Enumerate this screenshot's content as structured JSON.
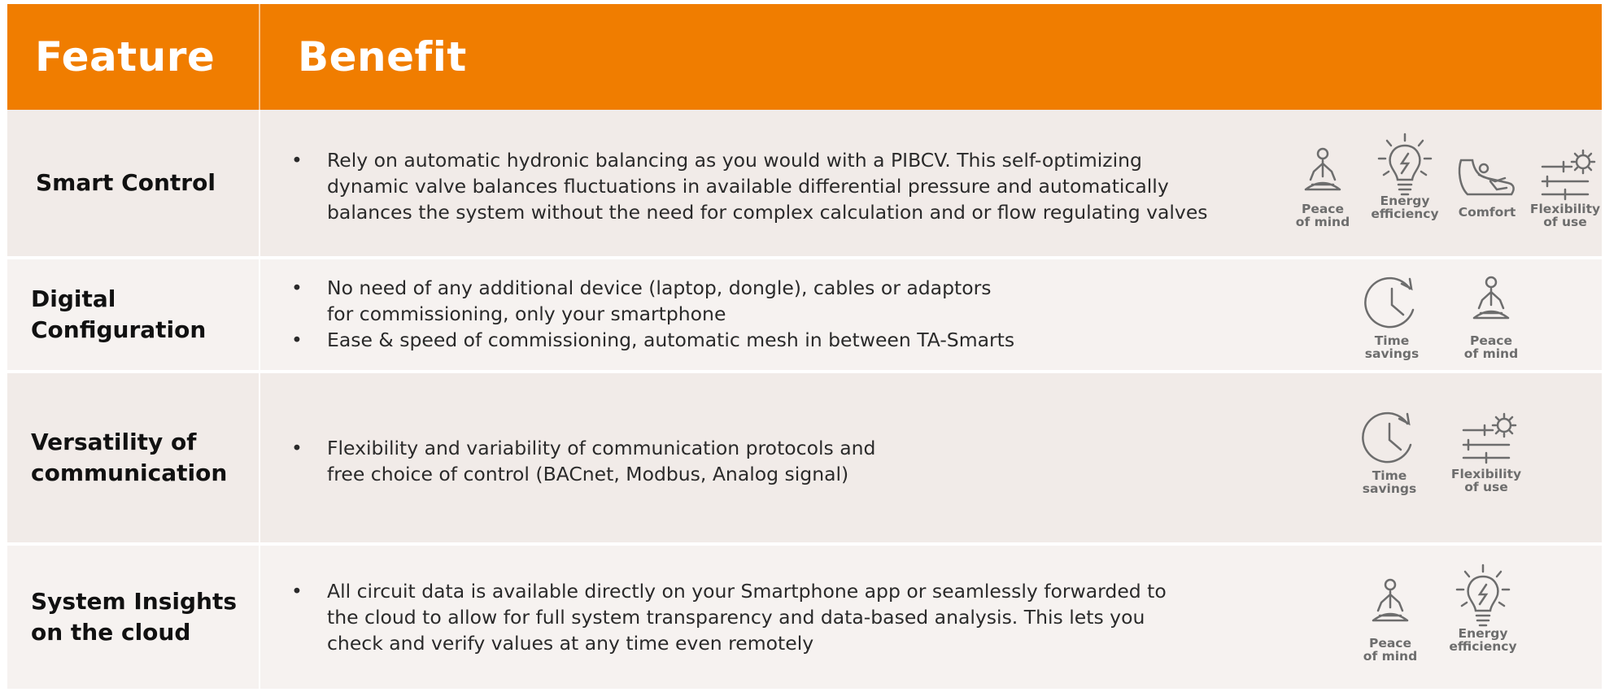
{
  "header": {
    "feature": "Feature",
    "benefit": "Benefit"
  },
  "colors": {
    "header_bg": "#f07d00",
    "row_dark": "#f1ebe8",
    "row_light": "#f6f2f0",
    "icon": "#6d6d6d"
  },
  "rows": [
    {
      "feature": "Smart Control",
      "bullets": [
        "Rely on automatic hydronic balancing as you would with a PIBCV. This self-optimizing\ndynamic valve balances fluctuations in available differential pressure and automatically\nbalances the system without the need for complex calculation and or flow regulating valves"
      ],
      "icons": [
        {
          "name": "peace-of-mind-icon",
          "label": "Peace\nof mind"
        },
        {
          "name": "energy-efficiency-icon",
          "label": "Energy\nefficiency"
        },
        {
          "name": "comfort-icon",
          "label": "Comfort"
        },
        {
          "name": "flexibility-of-use-icon",
          "label": "Flexibility\nof use"
        }
      ]
    },
    {
      "feature": "Digital\nConfiguration",
      "bullets": [
        "No need of any additional device (laptop, dongle), cables or adaptors\nfor commissioning, only your smartphone",
        "Ease & speed of commissioning, automatic mesh in between TA-Smarts"
      ],
      "icons": [
        {
          "name": "time-savings-icon",
          "label": "Time\nsavings"
        },
        {
          "name": "peace-of-mind-icon",
          "label": "Peace\nof mind"
        }
      ]
    },
    {
      "feature": "Versatility of\ncommunication",
      "bullets": [
        "Flexibility and variability of communication protocols and\nfree choice of control (BACnet, Modbus, Analog signal)"
      ],
      "icons": [
        {
          "name": "time-savings-icon",
          "label": "Time\nsavings"
        },
        {
          "name": "flexibility-of-use-icon",
          "label": "Flexibility\nof use"
        }
      ]
    },
    {
      "feature": "System Insights\non the cloud",
      "bullets": [
        "All circuit data is available directly on your Smartphone app or seamlessly forwarded to\nthe cloud to allow for full system transparency and data-based analysis. This lets you\ncheck and verify values at any time even remotely"
      ],
      "icons": [
        {
          "name": "peace-of-mind-icon",
          "label": "Peace\nof mind"
        },
        {
          "name": "energy-efficiency-icon",
          "label": "Energy\nefficiency"
        }
      ]
    }
  ]
}
